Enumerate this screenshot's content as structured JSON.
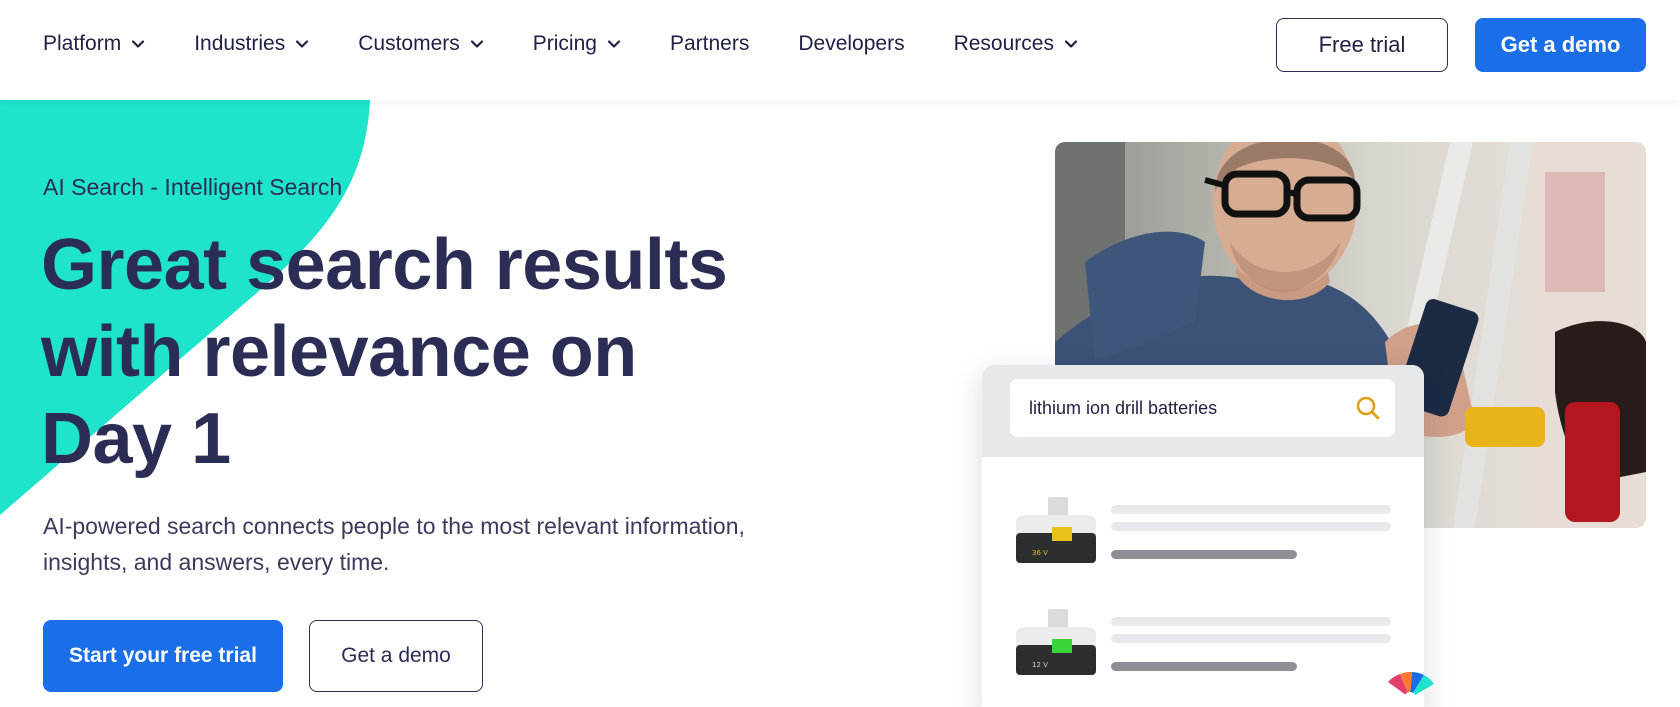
{
  "nav": {
    "items": [
      {
        "label": "Platform",
        "dropdown": true
      },
      {
        "label": "Industries",
        "dropdown": true
      },
      {
        "label": "Customers",
        "dropdown": true
      },
      {
        "label": "Pricing",
        "dropdown": true
      },
      {
        "label": "Partners",
        "dropdown": false
      },
      {
        "label": "Developers",
        "dropdown": false
      },
      {
        "label": "Resources",
        "dropdown": true
      }
    ],
    "free_trial_label": "Free trial",
    "get_demo_label": "Get a demo"
  },
  "hero": {
    "eyebrow": "AI Search - Intelligent Search",
    "headline": "Great search results with relevance on Day 1",
    "subtext": "AI-powered search connects people to the most relevant information, insights, and answers, every time.",
    "primary_cta": "Start your free trial",
    "secondary_cta": "Get a demo"
  },
  "search_card": {
    "query": "lithium ion drill batteries",
    "search_icon": "search-icon",
    "results": [
      {
        "label": "36 V",
        "accent": "#e8c21a"
      },
      {
        "label": "12 V",
        "accent": "#3ad33a"
      }
    ]
  },
  "colors": {
    "primary": "#1a6fe8",
    "teal": "#1ee4cc",
    "navy": "#2b2d55"
  }
}
